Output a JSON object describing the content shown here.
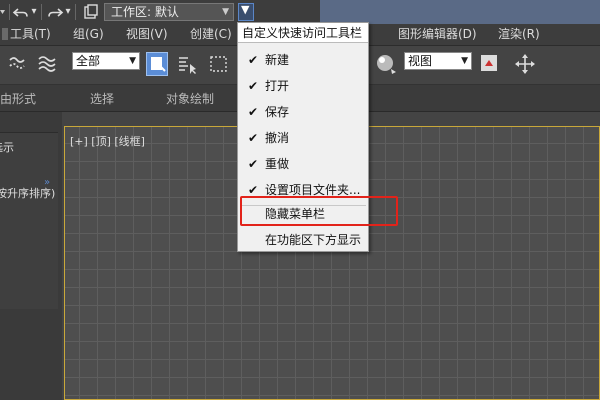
{
  "qat": {
    "workspace_label": "工作区: 默认",
    "workspace_arrow": "▼",
    "customize_arrow": "▼",
    "undo_arrow": "▾",
    "redo_arrow": "▾"
  },
  "menubar": {
    "items": [
      "工具(T)",
      "组(G)",
      "视图(V)",
      "创建(C)",
      "图形编辑器(D)",
      "渲染(R)"
    ]
  },
  "toolbar": {
    "selection_filter": "全部",
    "view_select": "视图",
    "dropdown_arrow": "▼"
  },
  "ribbon": {
    "tabs": [
      "由形式",
      "选择",
      "对象绘制"
    ]
  },
  "left_panel": {
    "lines": [
      "选示",
      "»",
      "按升序排序)"
    ]
  },
  "viewport": {
    "label": "[+] [顶] [线框]"
  },
  "dropdown": {
    "title": "自定义快速访问工具栏",
    "items": [
      {
        "label": "新建",
        "checked": "✔"
      },
      {
        "label": "打开",
        "checked": "✔"
      },
      {
        "label": "保存",
        "checked": "✔"
      },
      {
        "label": "撤消",
        "checked": "✔"
      },
      {
        "label": "重做",
        "checked": "✔"
      },
      {
        "label": "设置项目文件夹...",
        "checked": "✔"
      }
    ],
    "hide_menubar": "隐藏菜单栏",
    "show_below": "在功能区下方显示"
  },
  "colors": {
    "highlight": "#e2231a",
    "accent": "#5b8dd6",
    "viewport_border": "#c9a83a"
  }
}
